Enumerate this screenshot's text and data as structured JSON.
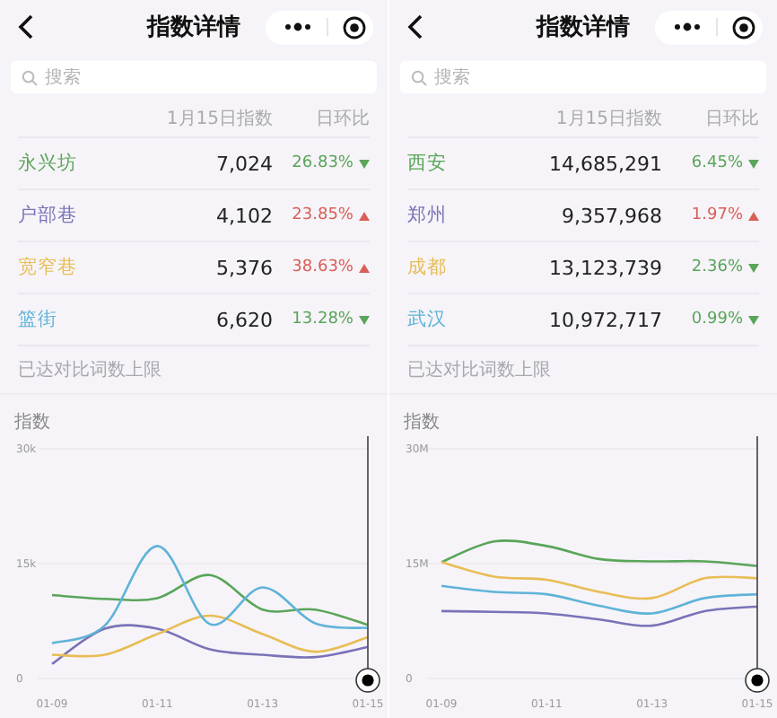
{
  "panels": [
    {
      "title": "指数详情",
      "search": {
        "placeholder": "搜索"
      },
      "columns": [
        "1月15日指数",
        "日环比"
      ],
      "rows": [
        {
          "name": "永兴坊",
          "value": "7,024",
          "change": "26.83%",
          "rising": false,
          "color": "#5aa55a"
        },
        {
          "name": "户部巷",
          "value": "4,102",
          "change": "23.85%",
          "rising": true,
          "color": "#7a72b8"
        },
        {
          "name": "宽窄巷",
          "value": "5,376",
          "change": "38.63%",
          "rising": true,
          "color": "#e8bd55"
        },
        {
          "name": "篮街",
          "value": "6,620",
          "change": "13.28%",
          "rising": false,
          "color": "#5fb3d8"
        }
      ],
      "hint": "已达对比词数上限",
      "chart_data": {
        "type": "line",
        "ylabel": "指数",
        "categories": [
          "01-09",
          null,
          "01-11",
          null,
          "01-13",
          null,
          "01-15"
        ],
        "ylim": [
          0,
          30000
        ],
        "yticks": [
          {
            "value": 0,
            "label": "0"
          },
          {
            "value": 15000,
            "label": "15k"
          },
          {
            "value": 30000,
            "label": "30k"
          }
        ],
        "series": [
          {
            "color": "#5aa55a",
            "values": [
              10900,
              10400,
              10500,
              13500,
              9000,
              9000,
              7000
            ]
          },
          {
            "color": "#7a72b8",
            "values": [
              1900,
              6500,
              6500,
              3800,
              3100,
              2800,
              4100
            ]
          },
          {
            "color": "#e8bd55",
            "values": [
              3100,
              3100,
              5800,
              8200,
              5800,
              3500,
              5400
            ]
          },
          {
            "color": "#5fb3d8",
            "values": [
              4600,
              6900,
              17300,
              7100,
              11900,
              7200,
              6600
            ]
          }
        ]
      }
    },
    {
      "title": "指数详情",
      "search": {
        "placeholder": "搜索"
      },
      "columns": [
        "1月15日指数",
        "日环比"
      ],
      "rows": [
        {
          "name": "西安",
          "value": "14,685,291",
          "change": "6.45%",
          "rising": false,
          "color": "#5aa55a"
        },
        {
          "name": "郑州",
          "value": "9,357,968",
          "change": "1.97%",
          "rising": true,
          "color": "#7a72b8"
        },
        {
          "name": "成都",
          "value": "13,123,739",
          "change": "2.36%",
          "rising": false,
          "color": "#e8bd55"
        },
        {
          "name": "武汉",
          "value": "10,972,717",
          "change": "0.99%",
          "rising": false,
          "color": "#5fb3d8"
        }
      ],
      "hint": "已达对比词数上限",
      "chart_data": {
        "type": "line",
        "ylabel": "指数",
        "categories": [
          "01-09",
          null,
          "01-11",
          null,
          "01-13",
          null,
          "01-15"
        ],
        "ylim": [
          0,
          30000000
        ],
        "yticks": [
          {
            "value": 0,
            "label": "0"
          },
          {
            "value": 15000000,
            "label": "15M"
          },
          {
            "value": 30000000,
            "label": "30M"
          }
        ],
        "series": [
          {
            "color": "#5aa55a",
            "values": [
              15200000,
              17900000,
              17300000,
              15600000,
              15300000,
              15300000,
              14700000
            ]
          },
          {
            "color": "#7a72b8",
            "values": [
              8800000,
              8700000,
              8500000,
              7700000,
              6900000,
              8800000,
              9400000
            ]
          },
          {
            "color": "#e8bd55",
            "values": [
              15200000,
              13300000,
              12900000,
              11300000,
              10500000,
              13100000,
              13100000
            ]
          },
          {
            "color": "#5fb3d8",
            "values": [
              12100000,
              11300000,
              11000000,
              9500000,
              8500000,
              10500000,
              11000000
            ]
          }
        ]
      }
    }
  ]
}
